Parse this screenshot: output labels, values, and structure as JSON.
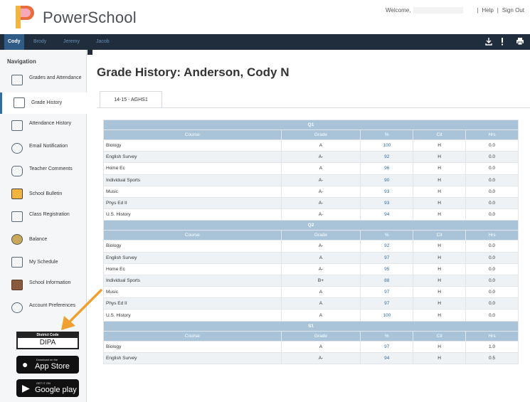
{
  "header": {
    "app_name": "PowerSchool",
    "welcome_label": "Welcome,",
    "help_label": "Help",
    "separator": "|",
    "signout_label": "Sign Out"
  },
  "students": [
    "Cody",
    "Brody",
    "Jeremy",
    "Jacob"
  ],
  "toolbar_icons": [
    "download-icon",
    "alert-icon",
    "print-icon"
  ],
  "sidebar": {
    "title": "Navigation",
    "items": [
      {
        "label": "Grades and Attendance",
        "icon": "grades-icon"
      },
      {
        "label": "Grade History",
        "icon": "history-icon"
      },
      {
        "label": "Attendance History",
        "icon": "attendance-icon"
      },
      {
        "label": "Email Notification",
        "icon": "email-icon"
      },
      {
        "label": "Teacher Comments",
        "icon": "comments-icon"
      },
      {
        "label": "School Bulletin",
        "icon": "bulletin-icon"
      },
      {
        "label": "Class Registration",
        "icon": "registration-icon"
      },
      {
        "label": "Balance",
        "icon": "balance-icon"
      },
      {
        "label": "My Schedule",
        "icon": "schedule-icon"
      },
      {
        "label": "School Information",
        "icon": "school-icon"
      },
      {
        "label": "Account Preferences",
        "icon": "preferences-icon"
      }
    ],
    "district": {
      "heading": "District Code",
      "code": "DIPA"
    },
    "appstore": {
      "small": "Download on the",
      "big": "App Store"
    },
    "googleplay": {
      "small": "GET IT ON",
      "big": "Google play"
    }
  },
  "main": {
    "title": "Grade History: Anderson, Cody N",
    "term_tab": "14-15 - AGHS1",
    "columns": {
      "course": "Course",
      "grade": "Grade",
      "pct": "%",
      "cit": "Cit",
      "hrs": "Hrs"
    },
    "sections": [
      {
        "name": "Q1",
        "rows": [
          {
            "course": "Biology",
            "grade": "A",
            "pct": "100",
            "cit": "H",
            "hrs": "0.0"
          },
          {
            "course": "English Survey",
            "grade": "A-",
            "pct": "92",
            "cit": "H",
            "hrs": "0.0"
          },
          {
            "course": "Home Ec",
            "grade": "A",
            "pct": "96",
            "cit": "H",
            "hrs": "0.0"
          },
          {
            "course": "Individual Sports",
            "grade": "A-",
            "pct": "90",
            "cit": "H",
            "hrs": "0.0"
          },
          {
            "course": "Music",
            "grade": "A-",
            "pct": "93",
            "cit": "H",
            "hrs": "0.0"
          },
          {
            "course": "Phys Ed II",
            "grade": "A-",
            "pct": "93",
            "cit": "H",
            "hrs": "0.0"
          },
          {
            "course": "U.S. History",
            "grade": "A-",
            "pct": "94",
            "cit": "H",
            "hrs": "0.0"
          }
        ]
      },
      {
        "name": "Q2",
        "rows": [
          {
            "course": "Biology",
            "grade": "A-",
            "pct": "92",
            "cit": "H",
            "hrs": "0.0"
          },
          {
            "course": "English Survey",
            "grade": "A",
            "pct": "97",
            "cit": "H",
            "hrs": "0.0"
          },
          {
            "course": "Home Ec",
            "grade": "A-",
            "pct": "95",
            "cit": "H",
            "hrs": "0.0"
          },
          {
            "course": "Individual Sports",
            "grade": "B+",
            "pct": "88",
            "cit": "H",
            "hrs": "0.0"
          },
          {
            "course": "Music",
            "grade": "A",
            "pct": "97",
            "cit": "H",
            "hrs": "0.0"
          },
          {
            "course": "Phys Ed II",
            "grade": "A",
            "pct": "97",
            "cit": "H",
            "hrs": "0.0"
          },
          {
            "course": "U.S. History",
            "grade": "A",
            "pct": "100",
            "cit": "H",
            "hrs": "0.0"
          }
        ]
      },
      {
        "name": "S1",
        "rows": [
          {
            "course": "Biology",
            "grade": "A",
            "pct": "97",
            "cit": "H",
            "hrs": "1.0"
          },
          {
            "course": "English Survey",
            "grade": "A-",
            "pct": "94",
            "cit": "H",
            "hrs": "0.5"
          }
        ]
      }
    ]
  },
  "colors": {
    "header_bar": "#1f2d3d",
    "active_student": "#2f5b86",
    "table_header": "#a9c4d8",
    "link_blue": "#2f6ea5",
    "annotation_arrow": "#f0a030"
  }
}
